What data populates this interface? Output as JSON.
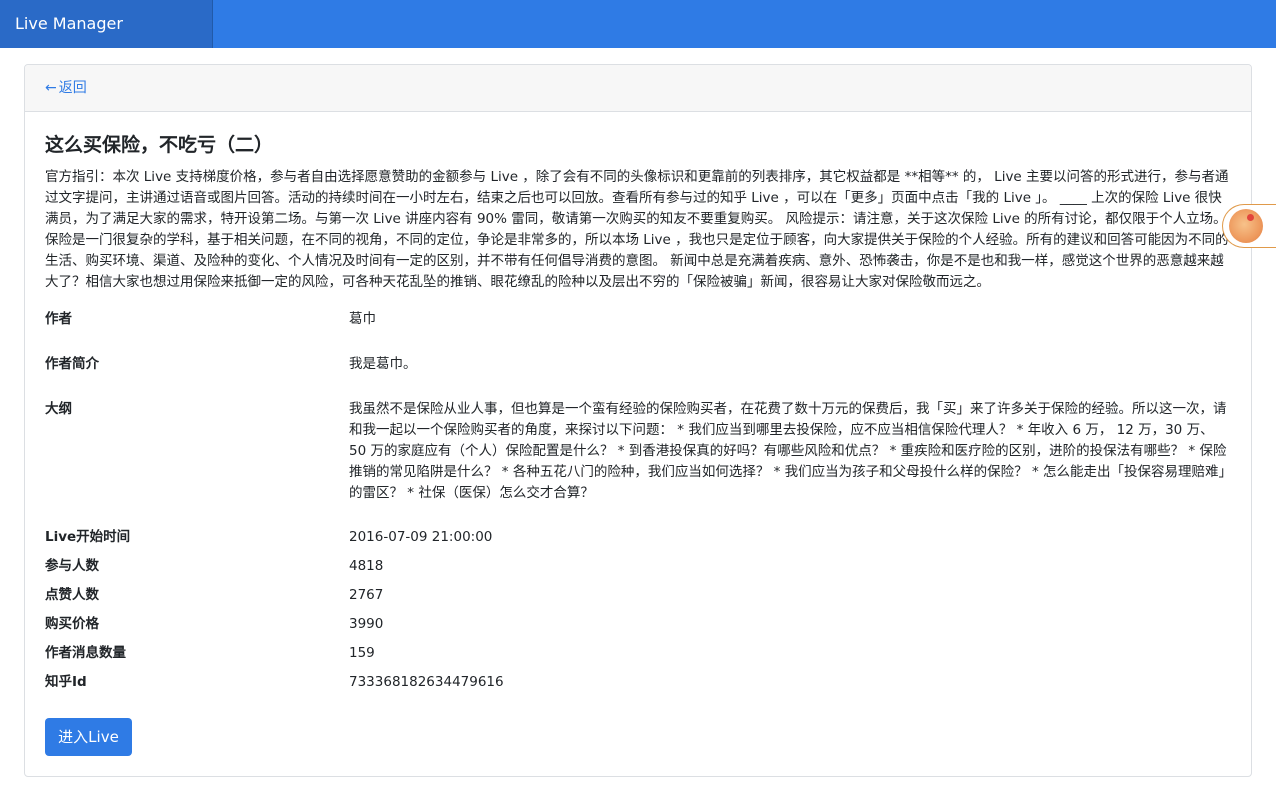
{
  "navbar": {
    "brand": "Live Manager"
  },
  "header": {
    "back_label": "返回",
    "back_arrow": "←"
  },
  "live": {
    "title": "这么买保险，不吃亏（二）",
    "description": "官方指引：本次 Live 支持梯度价格，参与者自由选择愿意赞助的金额参与 Live ，除了会有不同的头像标识和更靠前的列表排序，其它权益都是 **相等** 的， Live 主要以问答的形式进行，参与者通过文字提问，主讲通过语音或图片回答。活动的持续时间在一小时左右，结束之后也可以回放。查看所有参与过的知乎 Live ，可以在「更多」页面中点击「我的 Live 」。 ____ 上次的保险 Live 很快满员，为了满足大家的需求，特开设第二场。与第一次 Live 讲座内容有 90% 雷同，敬请第一次购买的知友不要重复购买。 风险提示：请注意，关于这次保险 Live 的所有讨论，都仅限于个人立场。保险是一门很复杂的学科，基于相关问题，在不同的视角，不同的定位，争论是非常多的，所以本场 Live ，我也只是定位于顾客，向大家提供关于保险的个人经验。所有的建议和回答可能因为不同的生活、购买环境、渠道、及险种的变化、个人情况及时间有一定的区别，并不带有任何倡导消费的意图。 新闻中总是充满着疾病、意外、恐怖袭击，你是不是也和我一样，感觉这个世界的恶意越来越大了？相信大家也想过用保险来抵御一定的风险，可各种天花乱坠的推销、眼花缭乱的险种以及层出不穷的「保险被骗」新闻，很容易让大家对保险敬而远之。",
    "fields": {
      "author": {
        "label": "作者",
        "value": "葛巾"
      },
      "bio": {
        "label": "作者简介",
        "value": "我是葛巾。"
      },
      "outline": {
        "label": "大纲",
        "value": "我虽然不是保险从业人事，但也算是一个蛮有经验的保险购买者，在花费了数十万元的保费后，我「买」来了许多关于保险的经验。所以这一次，请和我一起以一个保险购买者的角度，来探讨以下问题： * 我们应当到哪里去投保险，应不应当相信保险代理人？ * 年收入 6 万， 12 万，30 万、 50 万的家庭应有（个人）保险配置是什么？ * 到香港投保真的好吗？有哪些风险和优点？ * 重疾险和医疗险的区别，进阶的投保法有哪些？ * 保险推销的常见陷阱是什么？ * 各种五花八门的险种，我们应当如何选择？ * 我们应当为孩子和父母投什么样的保险？ * 怎么能走出「投保容易理赔难」的雷区？ * 社保（医保）怎么交才合算？"
      },
      "start_time": {
        "label": "Live开始时间",
        "value": "2016-07-09 21:00:00"
      },
      "participants": {
        "label": "参与人数",
        "value": "4818"
      },
      "likes": {
        "label": "点赞人数",
        "value": "2767"
      },
      "price": {
        "label": "购买价格",
        "value": "3990"
      },
      "messages": {
        "label": "作者消息数量",
        "value": "159"
      },
      "zhihu_id": {
        "label": "知乎Id",
        "value": "733368182634479616"
      }
    },
    "enter_button": "进入Live"
  },
  "icons": {
    "back": "arrow-left-icon",
    "floating": "avatar-widget-icon"
  },
  "colors": {
    "primary": "#2f7be5",
    "navbar": "#2f7be5",
    "brand_bg": "#2a6ac7",
    "card_header_bg": "#f7f7f7"
  }
}
